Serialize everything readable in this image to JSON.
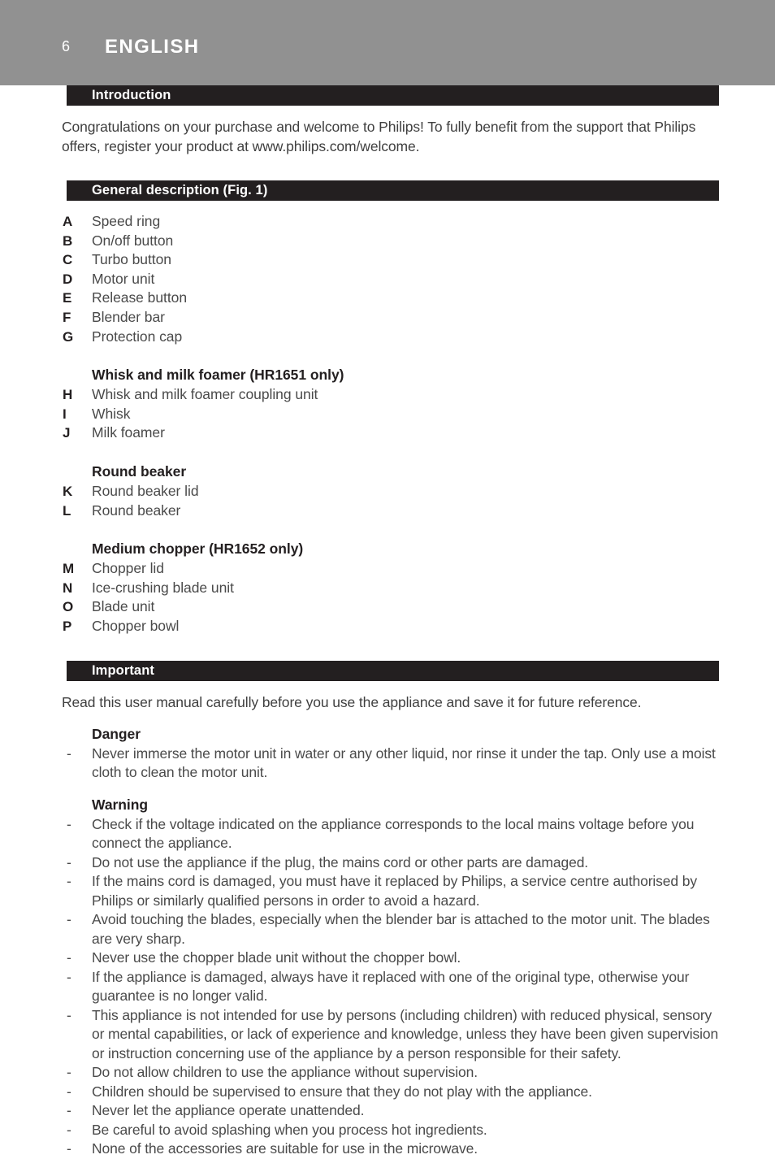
{
  "page": {
    "number": "6",
    "language_title": "ENGLISH",
    "header_band_color": "#919191",
    "section_bar_color": "#231f20",
    "text_color": "#4a4a4a"
  },
  "sections": {
    "introduction": {
      "bar_label": "Introduction",
      "paragraph": "Congratulations on your purchase and welcome to Philips! To fully benefit from the support that Philips offers, register your product at www.philips.com/welcome."
    },
    "general_description": {
      "bar_label": "General description (Fig. 1)",
      "main_parts": [
        {
          "letter": "A",
          "name": "Speed ring"
        },
        {
          "letter": "B",
          "name": "On/off button"
        },
        {
          "letter": "C",
          "name": "Turbo button"
        },
        {
          "letter": "D",
          "name": "Motor unit"
        },
        {
          "letter": "E",
          "name": "Release button"
        },
        {
          "letter": "F",
          "name": "Blender bar"
        },
        {
          "letter": "G",
          "name": "Protection cap"
        }
      ],
      "whisk_group": {
        "heading": "Whisk and milk foamer (HR1651 only)",
        "parts": [
          {
            "letter": "H",
            "name": "Whisk and milk foamer coupling unit"
          },
          {
            "letter": "I",
            "name": "Whisk"
          },
          {
            "letter": "J",
            "name": "Milk foamer"
          }
        ]
      },
      "beaker_group": {
        "heading": "Round beaker",
        "parts": [
          {
            "letter": "K",
            "name": "Round beaker lid"
          },
          {
            "letter": "L",
            "name": "Round beaker"
          }
        ]
      },
      "chopper_group": {
        "heading": "Medium chopper (HR1652 only)",
        "parts": [
          {
            "letter": "M",
            "name": "Chopper lid"
          },
          {
            "letter": "N",
            "name": "Ice-crushing blade unit"
          },
          {
            "letter": "O",
            "name": "Blade unit"
          },
          {
            "letter": "P",
            "name": "Chopper bowl"
          }
        ]
      }
    },
    "important": {
      "bar_label": "Important",
      "paragraph": "Read this user manual carefully before you use the appliance and save it for future reference.",
      "danger": {
        "heading": "Danger",
        "bullet_marker": "-",
        "items": [
          "Never immerse the motor unit in water or any other liquid, nor rinse it under the tap. Only use a moist cloth to clean the motor unit."
        ]
      },
      "warning": {
        "heading": "Warning",
        "bullet_marker": "-",
        "items": [
          "Check if the voltage indicated on the appliance corresponds to the local mains voltage before you connect the appliance.",
          "Do not use the appliance if the plug, the mains cord or other parts are damaged.",
          "If the mains cord is damaged, you must have it replaced by Philips, a service centre authorised by Philips or similarly qualified persons in order to avoid a hazard.",
          "Avoid touching the blades, especially when the blender bar is attached to the motor unit. The blades are very sharp.",
          "Never use the chopper blade unit without the chopper bowl.",
          "If the appliance is damaged, always have it replaced with one of the original type, otherwise your guarantee is no longer valid.",
          "This appliance is not intended for use by persons (including children) with reduced physical, sensory or mental capabilities, or lack of experience and knowledge, unless they have been given supervision or instruction concerning use of the appliance by a person responsible for their safety.",
          "Do not allow children to use the appliance without supervision.",
          "Children should be supervised to ensure that they do not play with the appliance.",
          "Never let the appliance operate unattended.",
          "Be careful to avoid splashing when you process hot ingredients.",
          "None of the accessories are suitable for use in the microwave."
        ]
      }
    }
  }
}
